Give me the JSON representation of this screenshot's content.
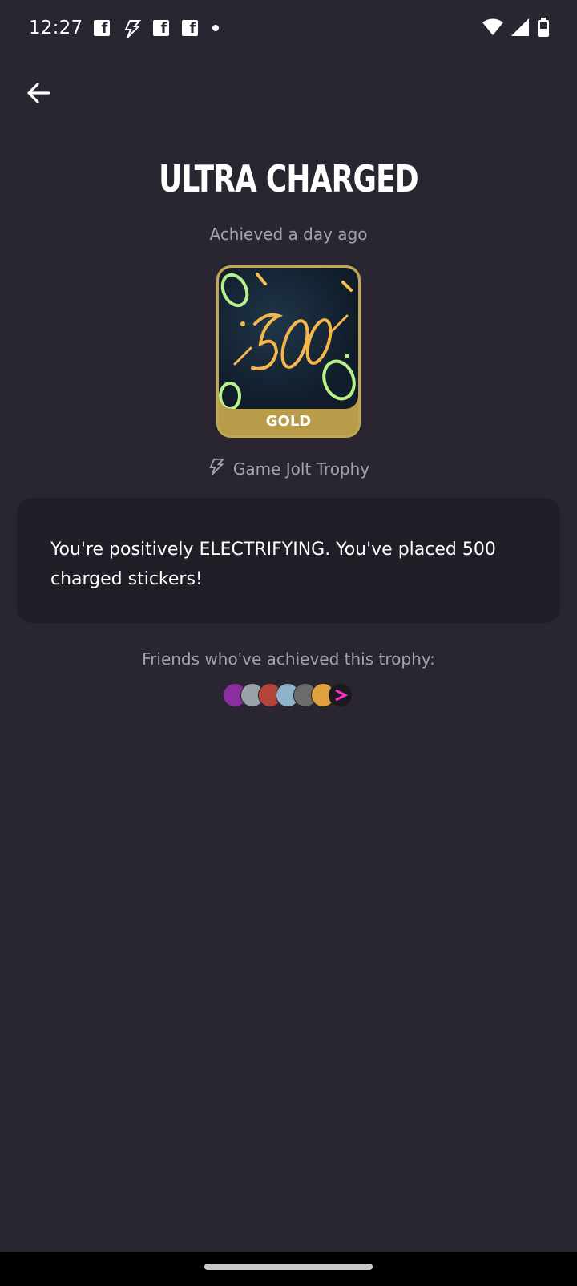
{
  "status_bar": {
    "time": "12:27",
    "icons": [
      "facebook-icon",
      "gamejolt-icon",
      "facebook-icon",
      "facebook-icon",
      "notification-dot"
    ],
    "right_icons": [
      "wifi-icon",
      "signal-icon",
      "battery-icon"
    ]
  },
  "header": {
    "back_icon": "arrow-left-icon"
  },
  "trophy": {
    "title": "ULTRA CHARGED",
    "achieved": "Achieved a day ago",
    "tier": "GOLD",
    "tier_color": "#b89c4a",
    "type_label": "Game Jolt Trophy",
    "description": "You're positively ELECTRIFYING. You've placed 500 charged stickers!"
  },
  "friends": {
    "label": "Friends who've achieved this trophy:",
    "avatars": [
      {
        "color": "#8b2fa0"
      },
      {
        "color": "#9aa0a8"
      },
      {
        "color": "#b3443a"
      },
      {
        "color": "#8fb3c8"
      },
      {
        "color": "#6b6b6b"
      },
      {
        "color": "#e0a040"
      },
      {
        "color": "#1a1a1a"
      }
    ]
  }
}
